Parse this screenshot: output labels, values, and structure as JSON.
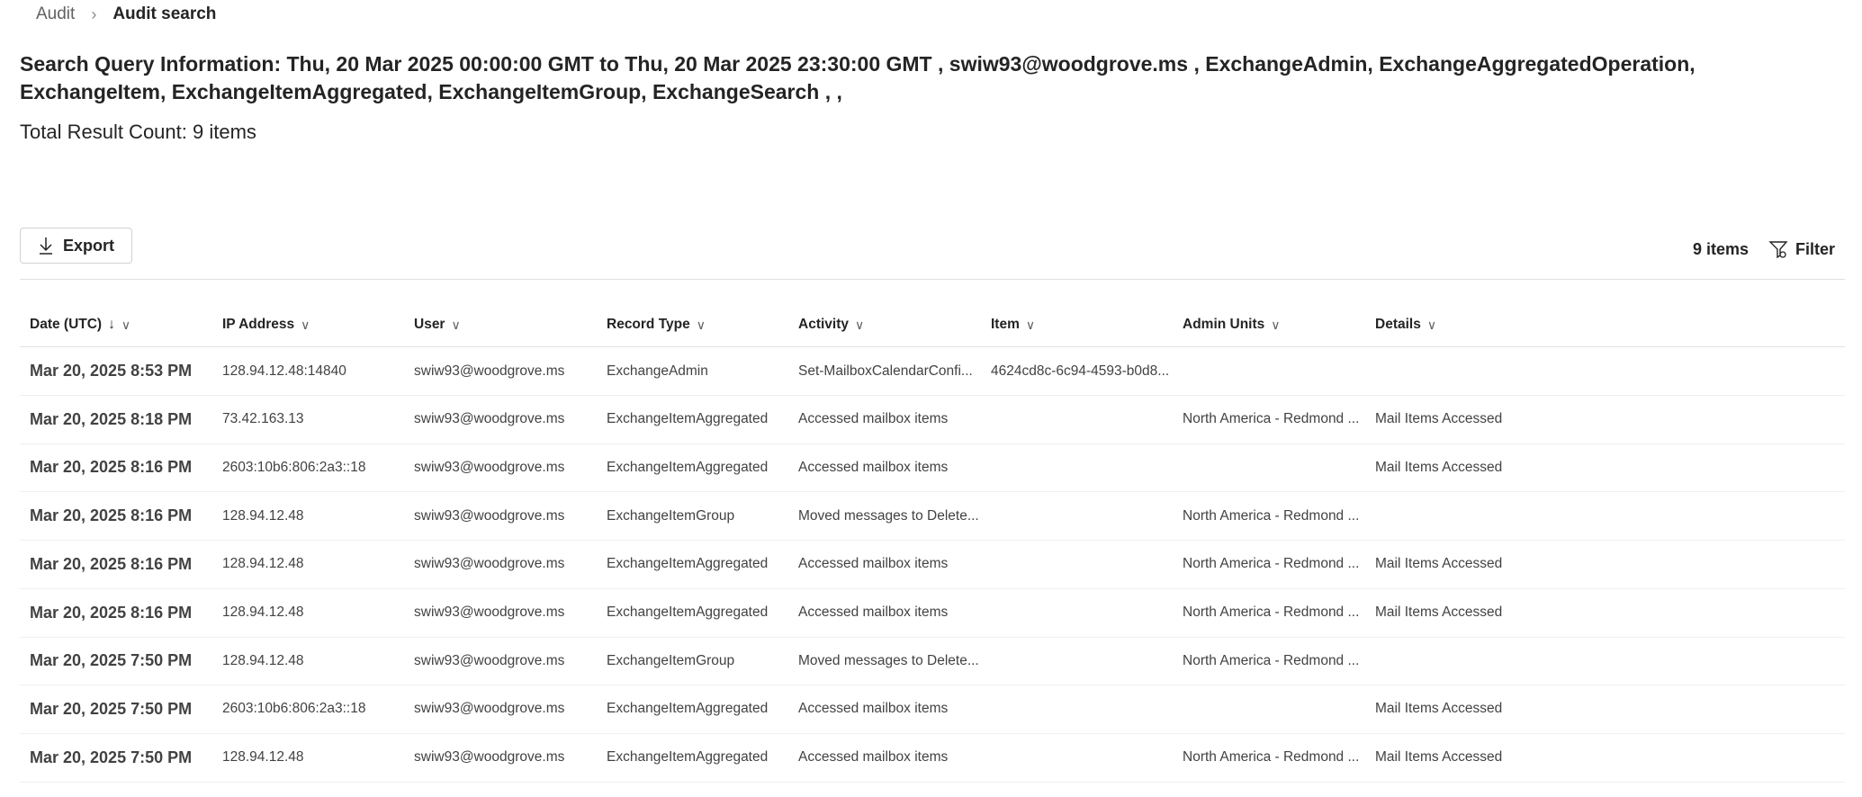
{
  "breadcrumb": {
    "parent": "Audit",
    "current": "Audit search"
  },
  "query_info": "Search Query Information: Thu, 20 Mar 2025 00:00:00 GMT to Thu, 20 Mar 2025 23:30:00 GMT , swiw93@woodgrove.ms , ExchangeAdmin, ExchangeAggregatedOperation, ExchangeItem, ExchangeItemAggregated, ExchangeItemGroup, ExchangeSearch , ,",
  "total_result": "Total Result Count: 9 items",
  "toolbar": {
    "export_label": "Export",
    "item_count": "9 items",
    "filter_label": "Filter"
  },
  "table": {
    "columns": [
      "Date (UTC)",
      "IP Address",
      "User",
      "Record Type",
      "Activity",
      "Item",
      "Admin Units",
      "Details"
    ],
    "rows": [
      [
        "Mar 20, 2025 8:53 PM",
        "128.94.12.48:14840",
        "swiw93@woodgrove.ms",
        "ExchangeAdmin",
        "Set-MailboxCalendarConfi...",
        "4624cd8c-6c94-4593-b0d8...",
        "",
        ""
      ],
      [
        "Mar 20, 2025 8:18 PM",
        "73.42.163.13",
        "swiw93@woodgrove.ms",
        "ExchangeItemAggregated",
        "Accessed mailbox items",
        "",
        "North America - Redmond ...",
        "Mail Items Accessed"
      ],
      [
        "Mar 20, 2025 8:16 PM",
        "2603:10b6:806:2a3::18",
        "swiw93@woodgrove.ms",
        "ExchangeItemAggregated",
        "Accessed mailbox items",
        "",
        "",
        "Mail Items Accessed"
      ],
      [
        "Mar 20, 2025 8:16 PM",
        "128.94.12.48",
        "swiw93@woodgrove.ms",
        "ExchangeItemGroup",
        "Moved messages to Delete...",
        "",
        "North America - Redmond ...",
        ""
      ],
      [
        "Mar 20, 2025 8:16 PM",
        "128.94.12.48",
        "swiw93@woodgrove.ms",
        "ExchangeItemAggregated",
        "Accessed mailbox items",
        "",
        "North America - Redmond ...",
        "Mail Items Accessed"
      ],
      [
        "Mar 20, 2025 8:16 PM",
        "128.94.12.48",
        "swiw93@woodgrove.ms",
        "ExchangeItemAggregated",
        "Accessed mailbox items",
        "",
        "North America - Redmond ...",
        "Mail Items Accessed"
      ],
      [
        "Mar 20, 2025 7:50 PM",
        "128.94.12.48",
        "swiw93@woodgrove.ms",
        "ExchangeItemGroup",
        "Moved messages to Delete...",
        "",
        "North America - Redmond ...",
        ""
      ],
      [
        "Mar 20, 2025 7:50 PM",
        "2603:10b6:806:2a3::18",
        "swiw93@woodgrove.ms",
        "ExchangeItemAggregated",
        "Accessed mailbox items",
        "",
        "",
        "Mail Items Accessed"
      ],
      [
        "Mar 20, 2025 7:50 PM",
        "128.94.12.48",
        "swiw93@woodgrove.ms",
        "ExchangeItemAggregated",
        "Accessed mailbox items",
        "",
        "North America - Redmond ...",
        "Mail Items Accessed"
      ]
    ],
    "sort_column": "Date (UTC)",
    "sort_direction": "descending"
  }
}
